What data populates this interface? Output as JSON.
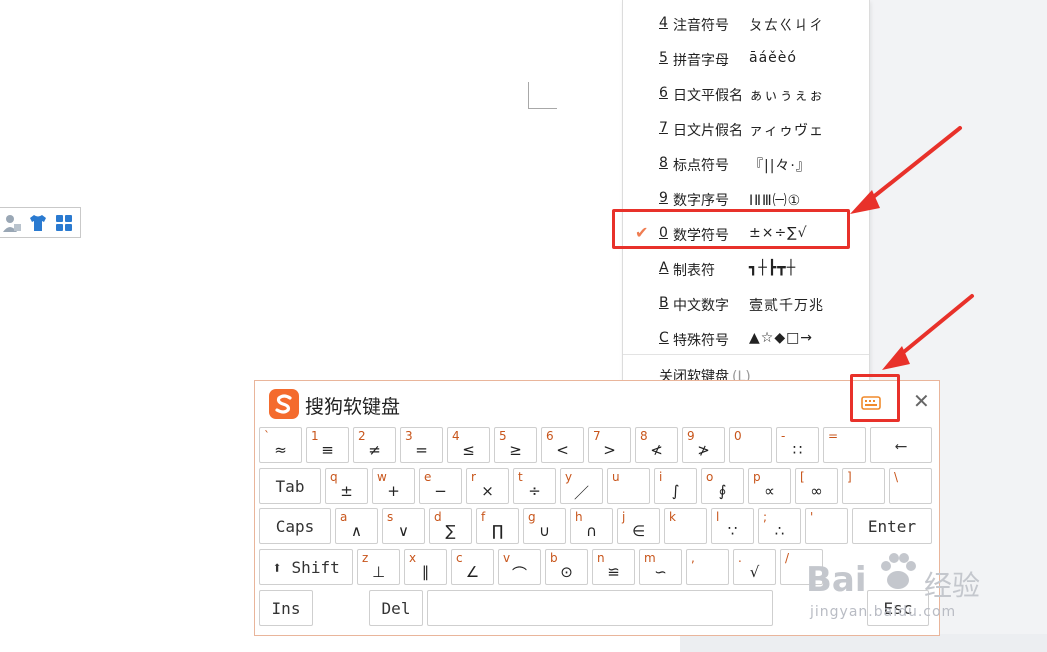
{
  "menu": {
    "items": [
      {
        "key": "4",
        "name": "注音符号",
        "sample": "ㄆㄊㄍㄐㄔ",
        "checked": false
      },
      {
        "key": "5",
        "name": "拼音字母",
        "sample": "āáěèó",
        "checked": false
      },
      {
        "key": "6",
        "name": "日文平假名",
        "sample": "ぁぃぅぇぉ",
        "checked": false
      },
      {
        "key": "7",
        "name": "日文片假名",
        "sample": "ァィゥヴェ",
        "checked": false
      },
      {
        "key": "8",
        "name": "标点符号",
        "sample": "『||々·』",
        "checked": false
      },
      {
        "key": "9",
        "name": "数字序号",
        "sample": "ⅠⅡⅢ㈠①",
        "checked": false
      },
      {
        "key": "0",
        "name": "数学符号",
        "sample": "±×÷∑√",
        "checked": true
      },
      {
        "key": "A",
        "name": "制表符",
        "sample": "┓┼┣┳┼",
        "checked": false
      },
      {
        "key": "B",
        "name": "中文数字",
        "sample": "壹贰千万兆",
        "checked": false
      },
      {
        "key": "C",
        "name": "特殊符号",
        "sample": "▲☆◆□→",
        "checked": false
      }
    ],
    "close_label": "关闭软键盘",
    "close_accel": "(L)",
    "check_glyph": "✔"
  },
  "keyboard": {
    "title": "搜狗软键盘",
    "close_glyph": "✕",
    "rows": [
      [
        {
          "top": "`",
          "sym": "≈"
        },
        {
          "top": "1",
          "sym": "≡"
        },
        {
          "top": "2",
          "sym": "≠"
        },
        {
          "top": "3",
          "sym": "="
        },
        {
          "top": "4",
          "sym": "≤"
        },
        {
          "top": "5",
          "sym": "≥"
        },
        {
          "top": "6",
          "sym": "<"
        },
        {
          "top": "7",
          "sym": ">"
        },
        {
          "top": "8",
          "sym": "≮"
        },
        {
          "top": "9",
          "sym": "≯"
        },
        {
          "top": "0",
          "sym": ""
        },
        {
          "top": "-",
          "sym": "∷"
        },
        {
          "top": "=",
          "sym": ""
        },
        {
          "label": "⟵"
        }
      ],
      [
        {
          "label": "Tab"
        },
        {
          "top": "q",
          "sym": "±"
        },
        {
          "top": "w",
          "sym": "+"
        },
        {
          "top": "e",
          "sym": "−"
        },
        {
          "top": "r",
          "sym": "×"
        },
        {
          "top": "t",
          "sym": "÷"
        },
        {
          "top": "y",
          "sym": "／"
        },
        {
          "top": "u",
          "sym": ""
        },
        {
          "top": "i",
          "sym": "∫"
        },
        {
          "top": "o",
          "sym": "∮"
        },
        {
          "top": "p",
          "sym": "∝"
        },
        {
          "top": "[",
          "sym": "∞"
        },
        {
          "top": "]",
          "sym": ""
        },
        {
          "top": "\\",
          "sym": ""
        }
      ],
      [
        {
          "label": "Caps"
        },
        {
          "top": "a",
          "sym": "∧"
        },
        {
          "top": "s",
          "sym": "∨"
        },
        {
          "top": "d",
          "sym": "∑"
        },
        {
          "top": "f",
          "sym": "∏"
        },
        {
          "top": "g",
          "sym": "∪"
        },
        {
          "top": "h",
          "sym": "∩"
        },
        {
          "top": "j",
          "sym": "∈"
        },
        {
          "top": "k",
          "sym": ""
        },
        {
          "top": "l",
          "sym": "∵"
        },
        {
          "top": ";",
          "sym": "∴"
        },
        {
          "top": "'",
          "sym": ""
        },
        {
          "label": "Enter"
        }
      ],
      [
        {
          "label": "⬆ Shift"
        },
        {
          "top": "z",
          "sym": "⊥"
        },
        {
          "top": "x",
          "sym": "∥"
        },
        {
          "top": "c",
          "sym": "∠"
        },
        {
          "top": "v",
          "sym": "⌒"
        },
        {
          "top": "b",
          "sym": "⊙"
        },
        {
          "top": "n",
          "sym": "≌"
        },
        {
          "top": "m",
          "sym": "∽"
        },
        {
          "top": ",",
          "sym": ""
        },
        {
          "top": ".",
          "sym": "√"
        },
        {
          "top": "/",
          "sym": ""
        }
      ],
      [
        {
          "label": "Ins"
        },
        {
          "label": "Del"
        },
        {
          "label": ""
        },
        {
          "label": "Esc"
        }
      ]
    ]
  },
  "watermark": {
    "word": "Bai",
    "cn": "经验",
    "url": "jingyan.baidu.com"
  },
  "colors": {
    "accent_orange": "#ef7d52",
    "highlight_red": "#e8312a",
    "key_letter": "#c8551b"
  }
}
